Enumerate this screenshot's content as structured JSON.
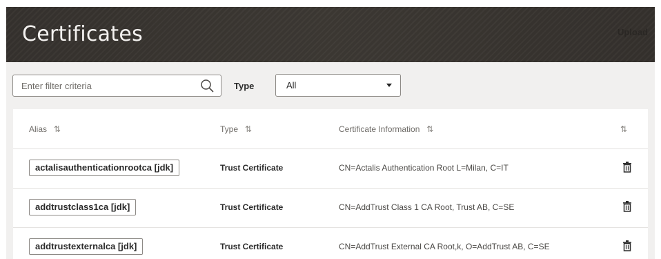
{
  "header": {
    "title": "Certificates",
    "upload_label": "Upload"
  },
  "filter": {
    "placeholder": "Enter filter criteria",
    "value": "",
    "search_icon": "search-icon",
    "type_label": "Type",
    "type_selected": "All"
  },
  "table": {
    "columns": [
      {
        "label": "Alias"
      },
      {
        "label": "Type"
      },
      {
        "label": "Certificate Information"
      },
      {
        "label": ""
      }
    ],
    "sort_icon": "⇅",
    "rows": [
      {
        "alias": "actalisauthenticationrootca [jdk]",
        "type": "Trust Certificate",
        "info": "CN=Actalis Authentication Root  L=Milan, C=IT"
      },
      {
        "alias": "addtrustclass1ca [jdk]",
        "type": "Trust Certificate",
        "info": "CN=AddTrust Class 1 CA Root, Trust AB, C=SE"
      },
      {
        "alias": "addtrustexternalca [jdk]",
        "type": "Trust Certificate",
        "info": "CN=AddTrust External CA Root,k, O=AddTrust AB, C=SE"
      }
    ]
  }
}
